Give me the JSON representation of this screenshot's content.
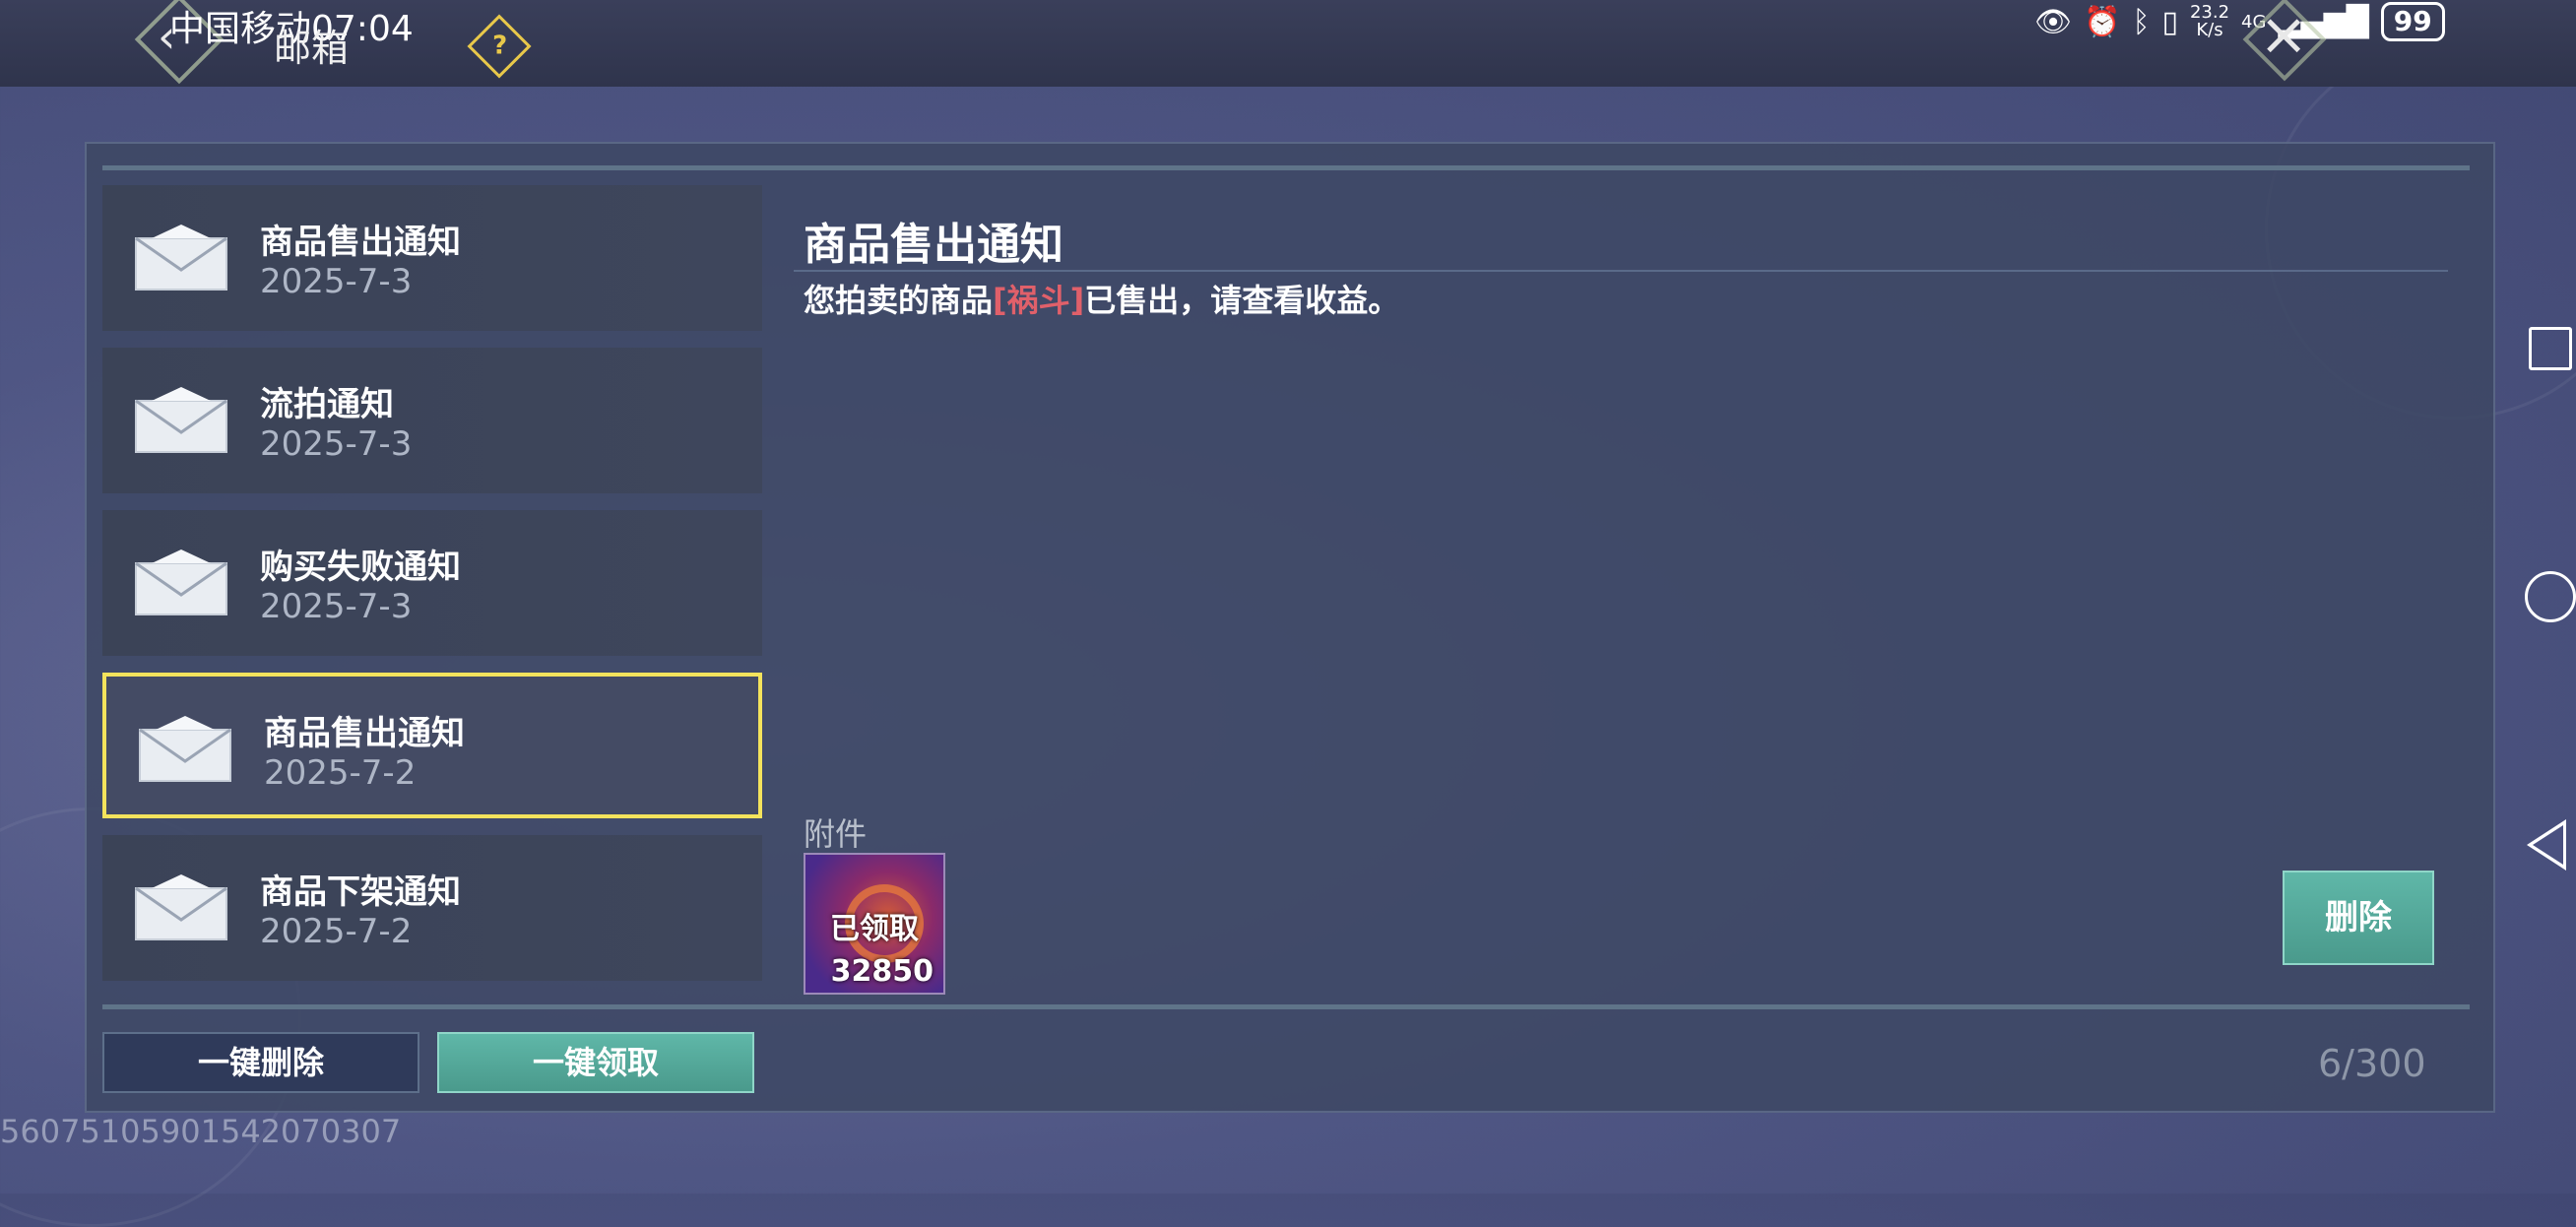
{
  "status_bar": {
    "carrier_time": "中国移动07:04",
    "net_speed_value": "23.2",
    "net_speed_unit": "K/s",
    "network": "4G",
    "battery": "99"
  },
  "header": {
    "title": "邮箱",
    "help_label": "?"
  },
  "mail_list": [
    {
      "title": "商品售出通知",
      "date": "2025-7-3"
    },
    {
      "title": "流拍通知",
      "date": "2025-7-3"
    },
    {
      "title": "购买失败通知",
      "date": "2025-7-3"
    },
    {
      "title": "商品售出通知",
      "date": "2025-7-2"
    },
    {
      "title": "商品下架通知",
      "date": "2025-7-2"
    }
  ],
  "selected_index": 3,
  "detail": {
    "title": "商品售出通知",
    "body_prefix": "您拍卖的商品",
    "item_name": "[祸斗]",
    "body_suffix": "已售出，请查看收益。",
    "attachment_label": "附件",
    "attachment_status": "已领取",
    "attachment_count": "32850",
    "delete_label": "删除"
  },
  "footer": {
    "delete_all_label": "一键删除",
    "claim_all_label": "一键领取",
    "mail_count": "6/300"
  },
  "user_id": "5607510590154207030​7",
  "colors": {
    "selected_border": "#f4e35c",
    "accent_button": "#5fb7a8",
    "item_name": "#e0606a"
  }
}
